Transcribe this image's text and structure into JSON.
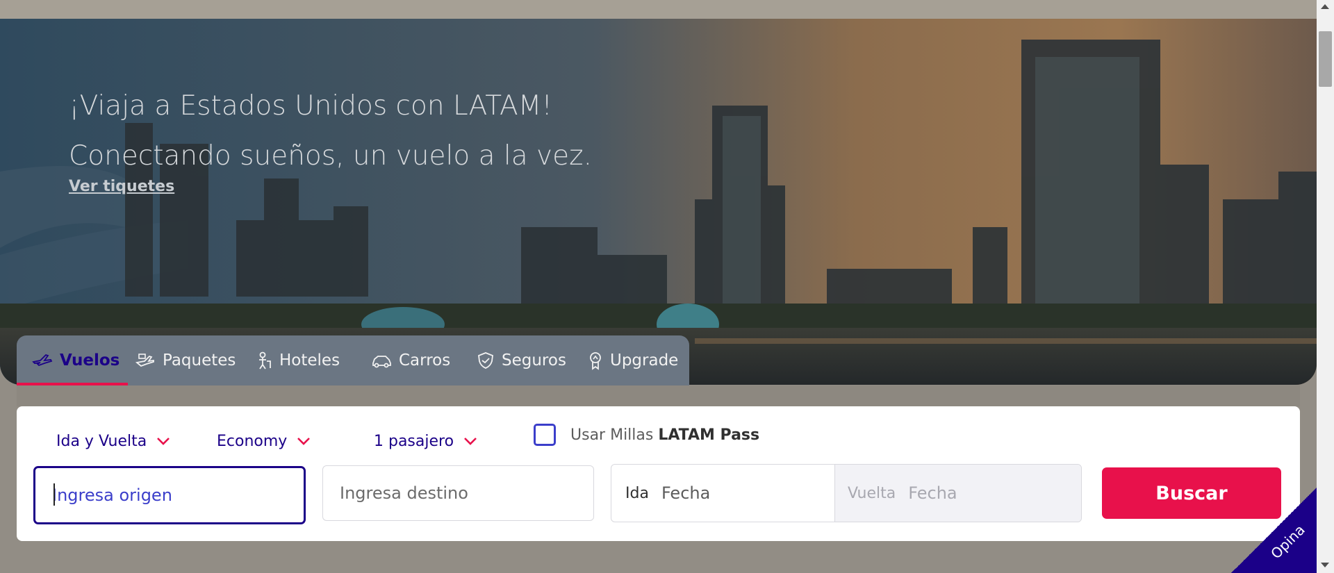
{
  "hero": {
    "title": "¡Viaja a Estados Unidos con LATAM! Conectando sueños, un vuelo a la vez.",
    "link": "Ver tiquetes"
  },
  "tabs": [
    {
      "label": "Vuelos",
      "icon": "plane-icon",
      "active": true
    },
    {
      "label": "Paquetes",
      "icon": "package-icon",
      "active": false
    },
    {
      "label": "Hoteles",
      "icon": "hotel-icon",
      "active": false
    },
    {
      "label": "Carros",
      "icon": "car-icon",
      "active": false
    },
    {
      "label": "Seguros",
      "icon": "shield-icon",
      "active": false
    },
    {
      "label": "Upgrade",
      "icon": "upgrade-icon",
      "active": false
    }
  ],
  "options": {
    "trip_type": "Ida y Vuelta",
    "cabin": "Economy",
    "passengers": "1 pasajero",
    "miles_prefix": "Usar Millas ",
    "miles_brand": "LATAM Pass"
  },
  "search": {
    "origin_placeholder": "Ingresa origen",
    "destination_placeholder": "Ingresa destino",
    "departure_label": "Ida",
    "departure_value": "Fecha",
    "return_label": "Vuelta",
    "return_value": "Fecha",
    "button": "Buscar"
  },
  "feedback": {
    "label": "Opina"
  },
  "colors": {
    "brand_indigo": "#1b0088",
    "accent_pink": "#e8114b",
    "checkbox_blue": "#3b3eca"
  }
}
